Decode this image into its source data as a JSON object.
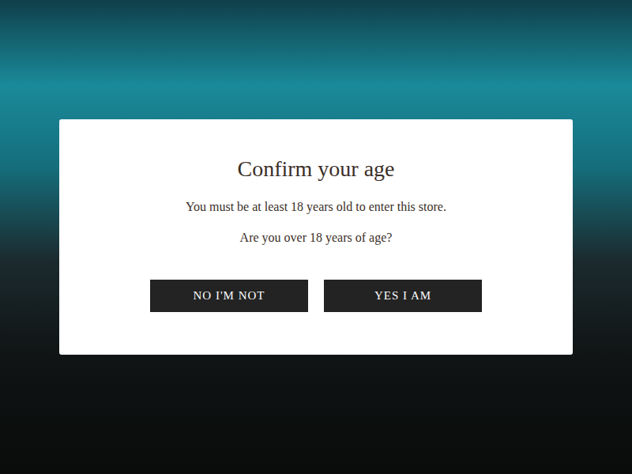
{
  "dialog": {
    "title": "Confirm your age",
    "message": "You must be at least 18 years old to enter this store.",
    "question": "Are you over 18 years of age?"
  },
  "buttons": [
    {
      "label": "NO I'M NOT"
    },
    {
      "label": "YES I AM"
    }
  ]
}
